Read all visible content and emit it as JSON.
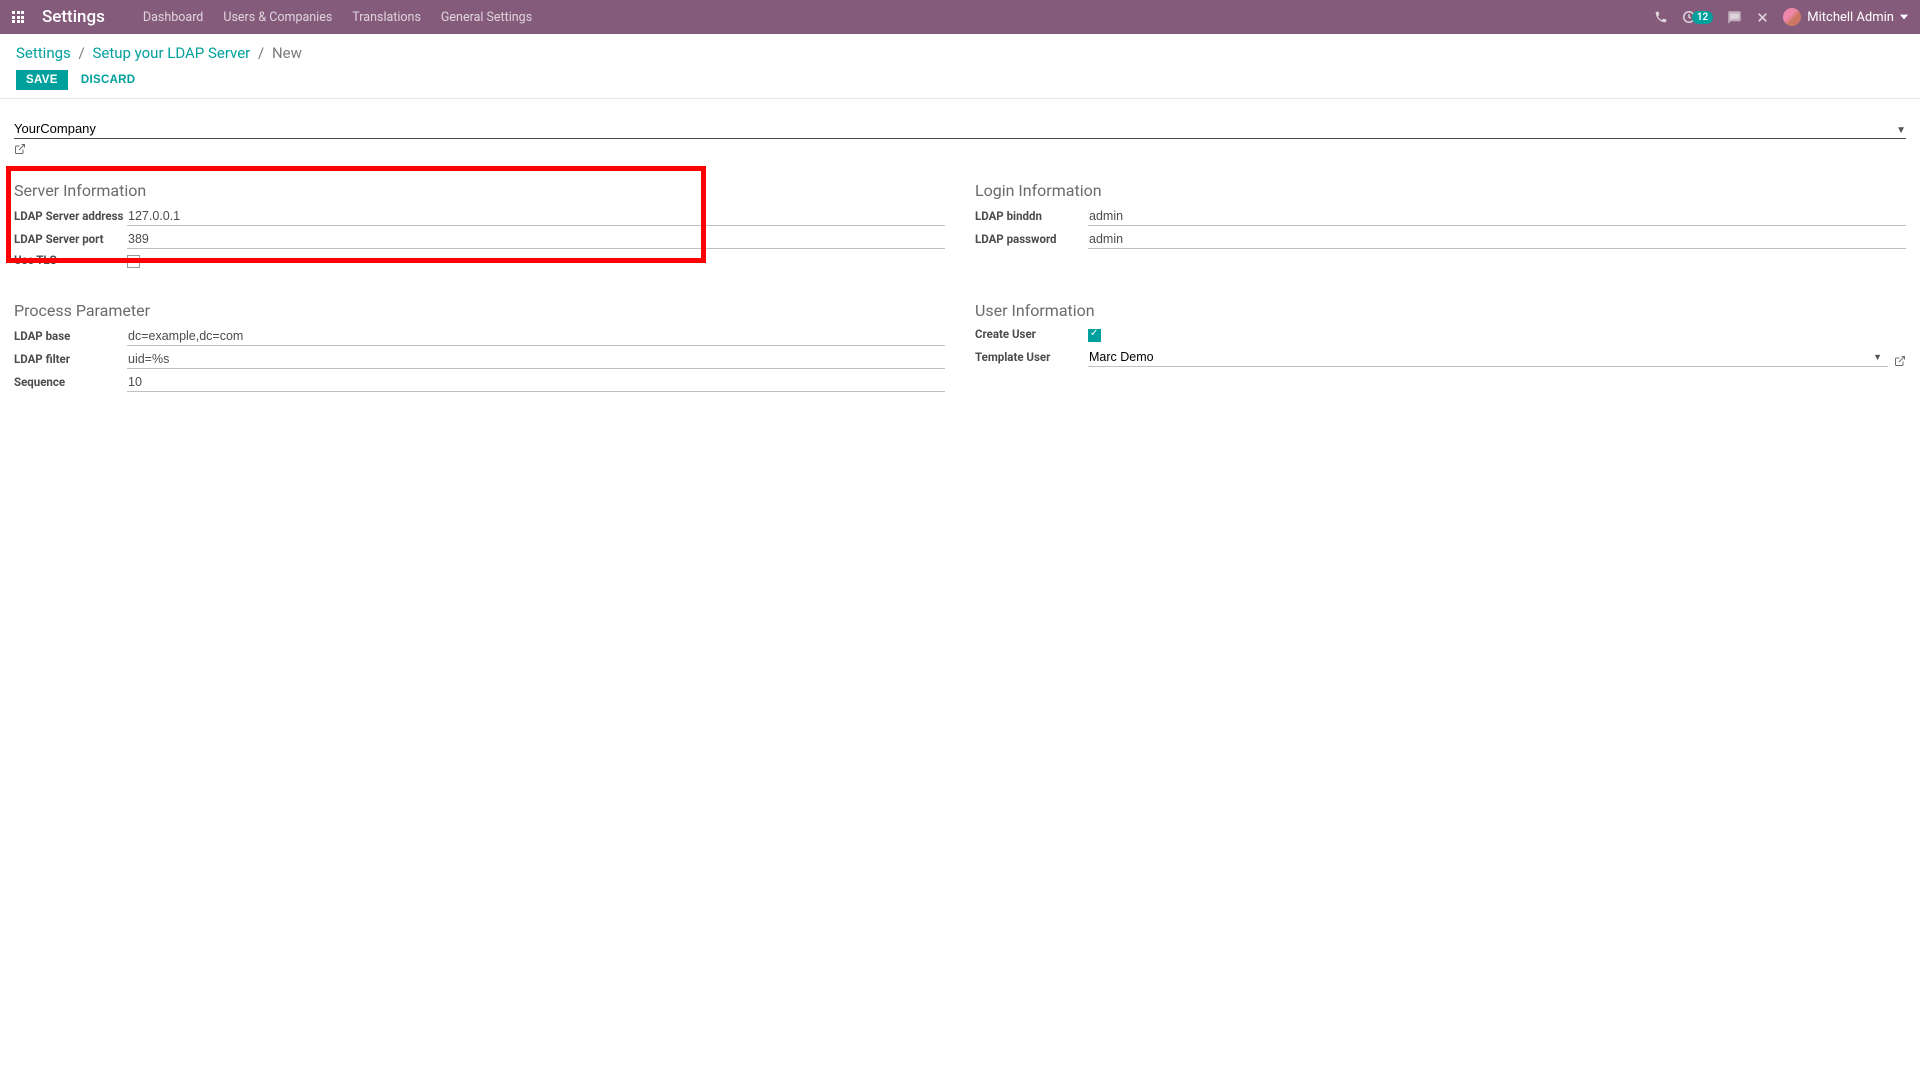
{
  "navbar": {
    "brand": "Settings",
    "links": [
      "Dashboard",
      "Users & Companies",
      "Translations",
      "General Settings"
    ],
    "badge_count": "12",
    "user_name": "Mitchell Admin"
  },
  "breadcrumb": {
    "root": "Settings",
    "parent": "Setup your LDAP Server",
    "current": "New"
  },
  "actions": {
    "save": "Save",
    "discard": "Discard"
  },
  "company": {
    "value": "YourCompany"
  },
  "groups": {
    "server_info": {
      "title": "Server Information",
      "address_label": "LDAP Server address",
      "address_value": "127.0.0.1",
      "port_label": "LDAP Server port",
      "port_value": "389",
      "tls_label": "Use TLS",
      "tls_checked": false
    },
    "login_info": {
      "title": "Login Information",
      "binddn_label": "LDAP binddn",
      "binddn_value": "admin",
      "password_label": "LDAP password",
      "password_value": "admin"
    },
    "process": {
      "title": "Process Parameter",
      "base_label": "LDAP base",
      "base_value": "dc=example,dc=com",
      "filter_label": "LDAP filter",
      "filter_value": "uid=%s",
      "sequence_label": "Sequence",
      "sequence_value": "10"
    },
    "user_info": {
      "title": "User Information",
      "create_label": "Create User",
      "create_checked": true,
      "template_label": "Template User",
      "template_value": "Marc Demo"
    }
  }
}
